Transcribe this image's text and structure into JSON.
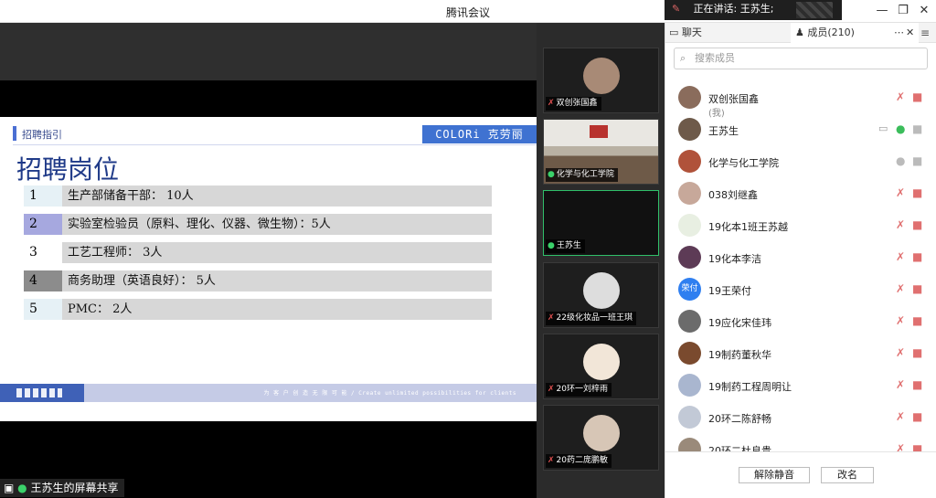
{
  "window": {
    "title": "腾讯会议"
  },
  "speaking": {
    "label": "正在讲话: 王苏生;"
  },
  "share": {
    "label": "王苏生的屏幕共享",
    "slide": {
      "header": "招聘指引",
      "logo": "COLORi 克劳丽",
      "title": "招聘岗位",
      "rows": [
        {
          "num": "1",
          "text": "生产部储备干部：   10人",
          "color": "#e6f1f6"
        },
        {
          "num": "2",
          "text": "实验室检验员（原料、理化、仪器、微生物）：5人",
          "color": "#a6a8df"
        },
        {
          "num": "3",
          "text": "工艺工程师：  3人",
          "color": "#ffffff"
        },
        {
          "num": "4",
          "text": "商务助理（英语良好）：  5人",
          "color": "#8c8c8c"
        },
        {
          "num": "5",
          "text": "PMC：  2人",
          "color": "#e6f1f6"
        }
      ],
      "footer_tag": "为 客 户 创 造 无 限 可 能 / Create unlimited possibilities for clients"
    }
  },
  "videos": [
    {
      "name": "双创张国鑫",
      "mic": "muted",
      "avatar_color": "#a88a76"
    },
    {
      "name": "化学与化工学院",
      "mic": "on",
      "avatar_color": "room"
    },
    {
      "name": "王苏生",
      "mic": "on",
      "avatar_color": "",
      "active": true
    },
    {
      "name": "22级化妆品一班王琪",
      "mic": "muted",
      "avatar_color": "#ddd"
    },
    {
      "name": "20环一刘梓雨",
      "mic": "muted",
      "avatar_color": "#f2e6d8"
    },
    {
      "name": "20药二庞鹏敏",
      "mic": "muted",
      "avatar_color": "#d7c6b6"
    }
  ],
  "panel": {
    "tab_chat": "聊天",
    "tab_members": "成员(210)",
    "search_placeholder": "搜索成员",
    "members": [
      {
        "name": "双创张国鑫",
        "sub": "(我)",
        "avatar_color": "#8a6c5c",
        "mic": "muted",
        "cam": "muted"
      },
      {
        "name": "王苏生",
        "sub": "",
        "avatar_color": "#6e5a4a",
        "mic": "on",
        "cam": "gray",
        "share": true
      },
      {
        "name": "化学与化工学院",
        "sub": "",
        "avatar_color": "#b0523a",
        "mic": "gray",
        "cam": "gray"
      },
      {
        "name": "038刘继鑫",
        "sub": "",
        "avatar_color": "#c7a89a",
        "mic": "muted",
        "cam": "muted"
      },
      {
        "name": "19化本1班王苏越",
        "sub": "",
        "avatar_color": "#e8efe2",
        "mic": "muted",
        "cam": "muted"
      },
      {
        "name": "19化本李洁",
        "sub": "",
        "avatar_color": "#5d3b56",
        "mic": "muted",
        "cam": "muted"
      },
      {
        "name": "19王荣付",
        "sub": "",
        "avatar_color": "#2f7ff0",
        "avatar_text": "荣付",
        "mic": "muted",
        "cam": "muted"
      },
      {
        "name": "19应化宋佳玮",
        "sub": "",
        "avatar_color": "#6b6b6b",
        "mic": "muted",
        "cam": "muted"
      },
      {
        "name": "19制药董秋华",
        "sub": "",
        "avatar_color": "#7a4a2e",
        "mic": "muted",
        "cam": "muted"
      },
      {
        "name": "19制药工程周明让",
        "sub": "",
        "avatar_color": "#a9b6cf",
        "mic": "muted",
        "cam": "muted"
      },
      {
        "name": "20环二陈舒畅",
        "sub": "",
        "avatar_color": "#c2c9d6",
        "mic": "muted",
        "cam": "muted"
      },
      {
        "name": "20环二杜良贵",
        "sub": "",
        "avatar_color": "#9a8a7a",
        "mic": "muted",
        "cam": "muted"
      }
    ],
    "unmute_all": "解除静音",
    "rename": "改名"
  }
}
